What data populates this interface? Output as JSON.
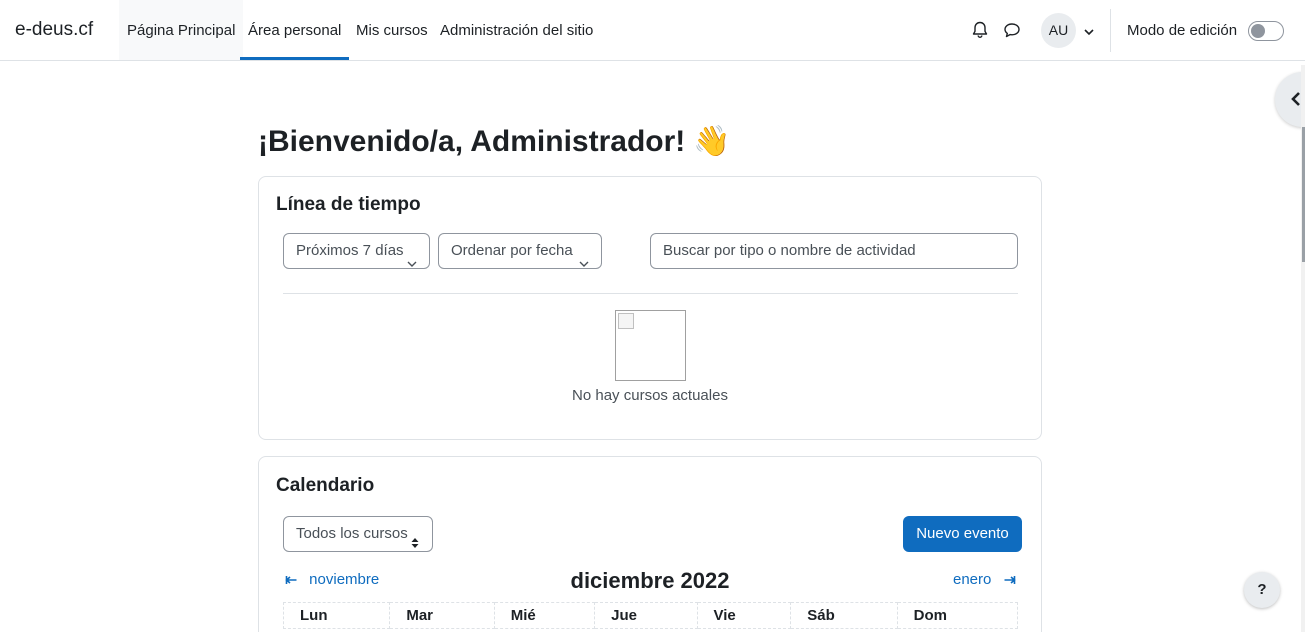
{
  "navbar": {
    "brand": "e-deus.cf",
    "items": [
      {
        "label": "Página Principal"
      },
      {
        "label": "Área personal"
      },
      {
        "label": "Mis cursos"
      },
      {
        "label": "Administración del sitio"
      }
    ],
    "active_item": "Área personal",
    "avatar_initials": "AU",
    "edit_mode_label": "Modo de edición",
    "edit_mode_on": false,
    "icons": [
      "bell-icon",
      "chat-icon",
      "chevron-down-icon"
    ]
  },
  "main": {
    "title": "¡Bienvenido/a, Administrador!",
    "title_emoji": "👋"
  },
  "timeline": {
    "title": "Línea de tiempo",
    "filter_select": "Próximos 7 días",
    "sort_select": "Ordenar por fecha",
    "search_placeholder": "Buscar por tipo o nombre de actividad",
    "empty_text": "No hay cursos actuales"
  },
  "calendar": {
    "title": "Calendario",
    "course_select": "Todos los cursos",
    "new_event_label": "Nuevo evento",
    "prev_month": "noviembre",
    "next_month": "enero",
    "month_title": "diciembre 2022",
    "weekdays": [
      "Lun",
      "Mar",
      "Mié",
      "Jue",
      "Vie",
      "Sáb",
      "Dom"
    ]
  },
  "help_label": "?",
  "colors": {
    "accent": "#0f6cbf",
    "text": "#1d2125",
    "border": "#dee2e6"
  }
}
